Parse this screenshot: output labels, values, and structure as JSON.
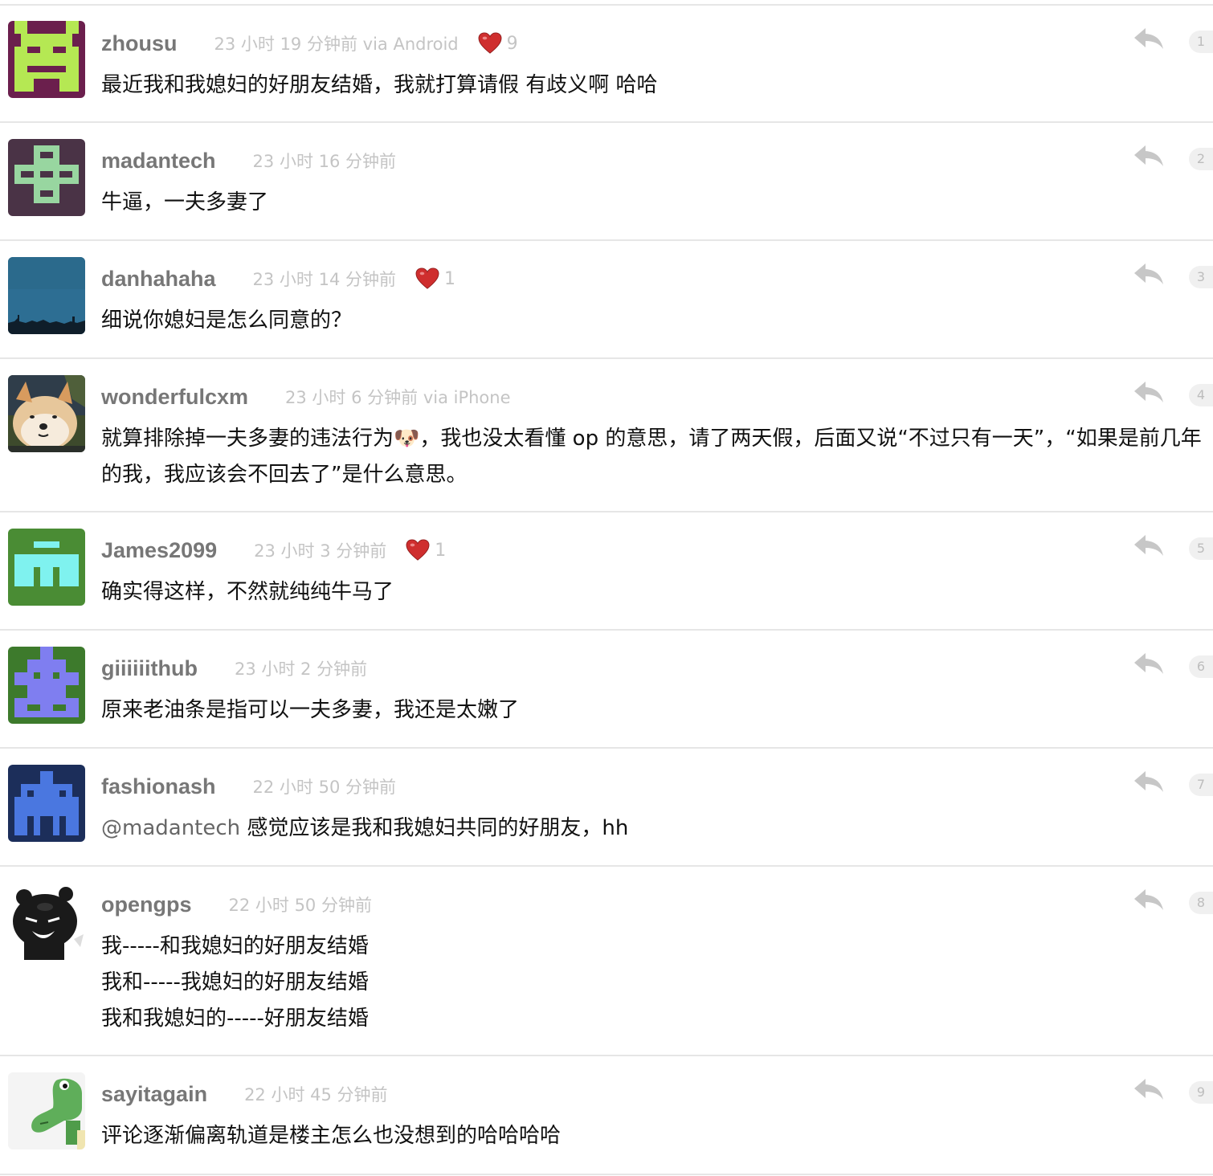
{
  "replies": [
    {
      "username": "zhousu",
      "time": "23 小时 19 分钟前 via Android",
      "thanks": "9",
      "content_lines": [
        "最近我和我媳妇的好朋友结婚，我就打算请假 有歧义啊 哈哈"
      ],
      "floor": "1"
    },
    {
      "username": "madantech",
      "time": "23 小时 16 分钟前",
      "content_lines": [
        "牛逼，一夫多妻了"
      ],
      "floor": "2"
    },
    {
      "username": "danhahaha",
      "time": "23 小时 14 分钟前",
      "thanks": "1",
      "content_lines": [
        "细说你媳妇是怎么同意的？"
      ],
      "floor": "3"
    },
    {
      "username": "wonderfulcxm",
      "time": "23 小时 6 分钟前 via iPhone",
      "content_part1": "就算排除掉一夫多妻的违法行为",
      "content_emoji": "🐶",
      "content_part2": "，我也没太看懂 op 的意思，请了两天假，后面又说“不过只有一天”，“如果是前几年的我，我应该会不回去了”是什么意思。",
      "floor": "4"
    },
    {
      "username": "James2099",
      "time": "23 小时 3 分钟前",
      "thanks": "1",
      "content_lines": [
        "确实得这样，不然就纯纯牛马了"
      ],
      "floor": "5"
    },
    {
      "username": "giiiiiithub",
      "time": "23 小时 2 分钟前",
      "content_lines": [
        "原来老油条是指可以一夫多妻，我还是太嫩了"
      ],
      "floor": "6"
    },
    {
      "username": "fashionash",
      "time": "22 小时 50 分钟前",
      "mention": "@madantech",
      "content_rest": " 感觉应该是我和我媳妇共同的好朋友，hh",
      "floor": "7"
    },
    {
      "username": "opengps",
      "time": "22 小时 50 分钟前",
      "content_lines": [
        "我-----和我媳妇的好朋友结婚",
        "我和-----我媳妇的好朋友结婚",
        "我和我媳妇的-----好朋友结婚"
      ],
      "floor": "8"
    },
    {
      "username": "sayitagain",
      "time": "22 小时 45 分钟前",
      "content_lines": [
        "评论逐渐偏离轨道是楼主怎么也没想到的哈哈哈哈"
      ],
      "floor": "9"
    }
  ],
  "colors": {
    "username": "#777777",
    "time": "#c4c4c4",
    "content": "#111111",
    "heart": "#d0312d",
    "divider": "#e6e6e6"
  },
  "icons": {
    "reply": "reply-arrow-icon",
    "thanks": "heart-icon"
  }
}
